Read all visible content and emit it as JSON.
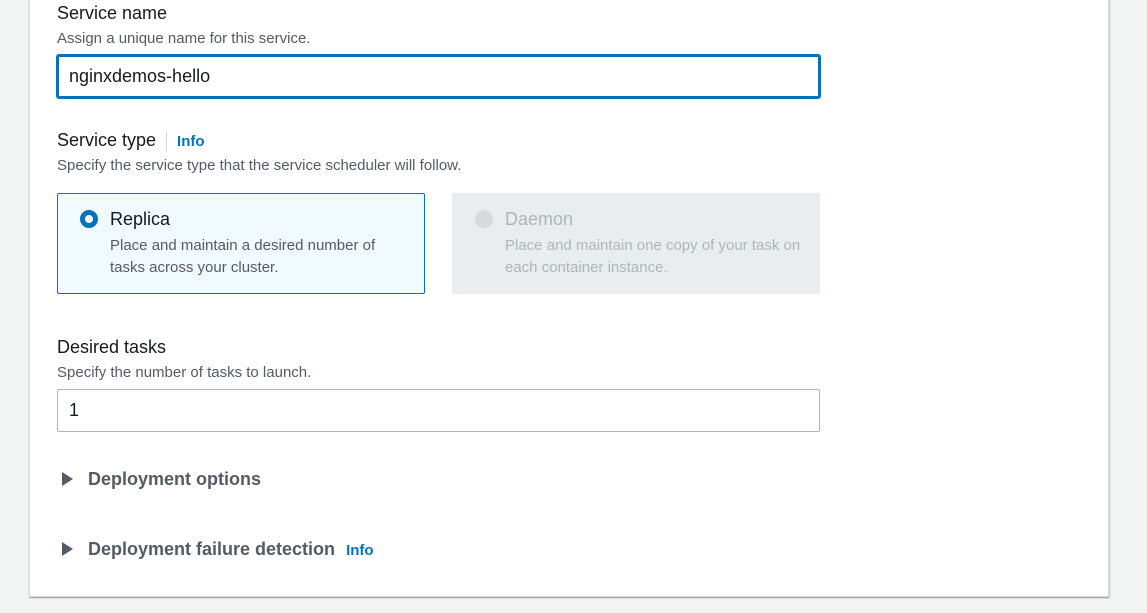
{
  "service_name": {
    "label": "Service name",
    "description": "Assign a unique name for this service.",
    "value": "nginxdemos-hello"
  },
  "service_type": {
    "label": "Service type",
    "info": "Info",
    "description": "Specify the service type that the service scheduler will follow.",
    "options": [
      {
        "title": "Replica",
        "description": "Place and maintain a desired number of tasks across your cluster.",
        "selected": true,
        "disabled": false
      },
      {
        "title": "Daemon",
        "description": "Place and maintain one copy of your task on each container instance.",
        "selected": false,
        "disabled": true
      }
    ]
  },
  "desired_tasks": {
    "label": "Desired tasks",
    "description": "Specify the number of tasks to launch.",
    "value": "1"
  },
  "sections": {
    "deployment_options": "Deployment options",
    "deployment_failure_detection": "Deployment failure detection",
    "failure_info": "Info"
  },
  "colors": {
    "accent": "#0073bb",
    "text": "#16191f",
    "muted": "#545b64",
    "disabled": "#aab7b8",
    "selected_bg": "#f1faff",
    "disabled_bg": "#eaeded"
  },
  "icons": {
    "radio_selected": "radio-selected-icon",
    "radio_disabled": "radio-disabled-icon",
    "expand": "caret-right-icon"
  }
}
